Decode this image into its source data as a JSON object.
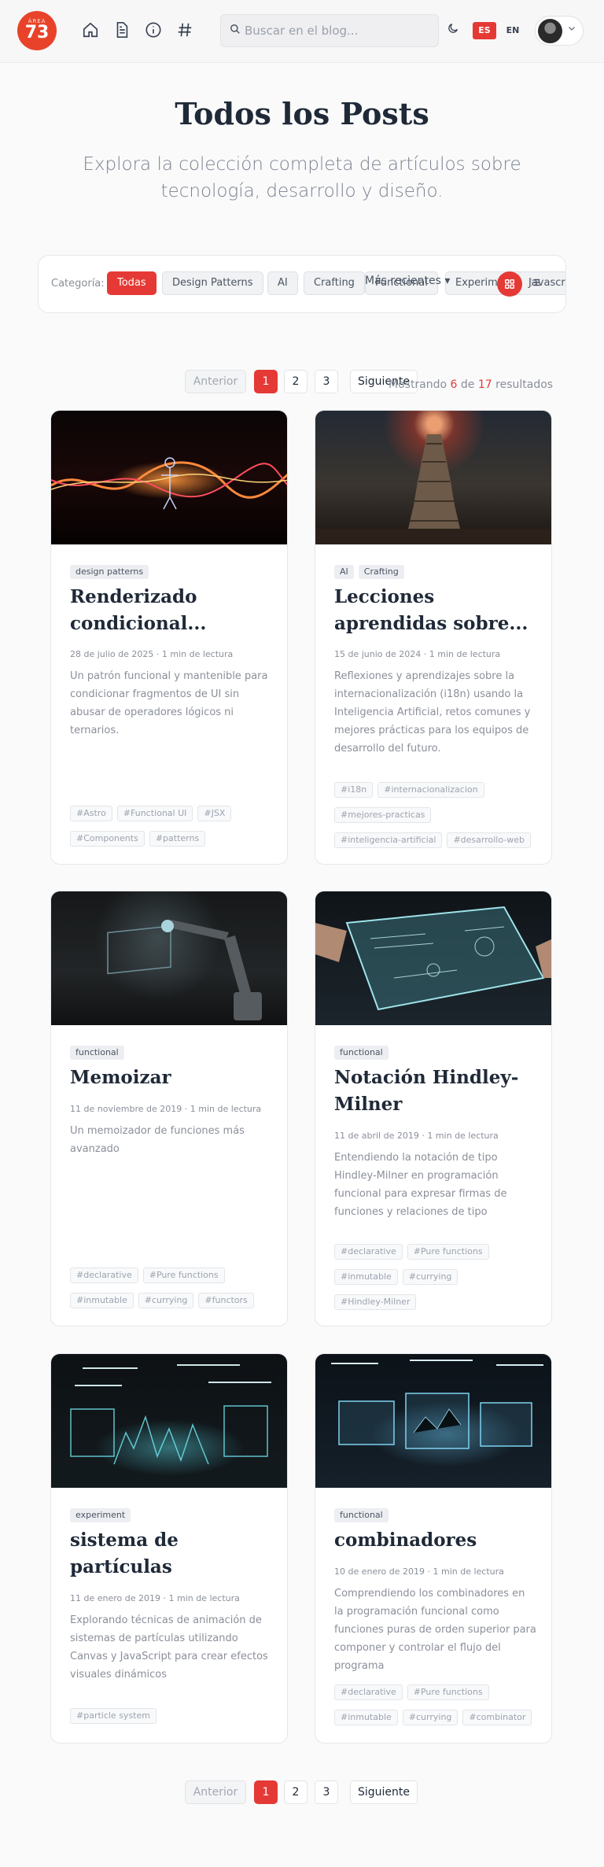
{
  "header": {
    "logo_top": "ÁREA",
    "logo_num": "73",
    "search_placeholder": "Buscar en el blog...",
    "lang_es": "ES",
    "lang_en": "EN"
  },
  "hero": {
    "title": "Todos los Posts",
    "subtitle": "Explora la colección completa de artículos sobre tecnología, desarrollo y diseño."
  },
  "filter": {
    "category_label": "Categoría:",
    "chips": [
      "Todas",
      "Design Patterns",
      "AI",
      "Crafting",
      "Functional",
      "Experiment",
      "Javascript"
    ],
    "sort_label": "Más recientes",
    "sort_selected": "Más recientes"
  },
  "pagination": {
    "prev": "Anterior",
    "pages": [
      "1",
      "2",
      "3"
    ],
    "next": "Siguiente"
  },
  "results": {
    "prefix": "Mostrando",
    "shown": "6",
    "middle": "de",
    "total": "17",
    "suffix": "resultados"
  },
  "posts": [
    {
      "categories": [
        "design patterns"
      ],
      "title": "Renderizado condicional...",
      "date": "28 de julio de 2025",
      "read_time": "1 min de lectura",
      "description": "Un patrón funcional y mantenible para condicionar fragmentos de UI sin abusar de operadores lógicos ni ternarios.",
      "tags": [
        "#Astro",
        "#Functional UI",
        "#JSX",
        "#Components",
        "#patterns"
      ]
    },
    {
      "categories": [
        "AI",
        "Crafting"
      ],
      "title": "Lecciones aprendidas sobre...",
      "date": "15 de junio de 2024",
      "read_time": "1 min de lectura",
      "description": "Reflexiones y aprendizajes sobre la internacionalización (i18n) usando la Inteligencia Artificial, retos comunes y mejores prácticas para los equipos de desarrollo del futuro.",
      "tags": [
        "#i18n",
        "#internacionalizacion",
        "#mejores-practicas",
        "#inteligencia-artificial",
        "#desarrollo-web"
      ]
    },
    {
      "categories": [
        "functional"
      ],
      "title": "Memoizar",
      "date": "11 de noviembre de 2019",
      "read_time": "1 min de lectura",
      "description": "Un memoizador de funciones más avanzado",
      "tags": [
        "#declarative",
        "#Pure functions",
        "#inmutable",
        "#currying",
        "#functors"
      ]
    },
    {
      "categories": [
        "functional"
      ],
      "title": "Notación Hindley-Milner",
      "date": "11 de abril de 2019",
      "read_time": "1 min de lectura",
      "description": "Entendiendo la notación de tipo Hindley-Milner en programación funcional para expresar firmas de funciones y relaciones de tipo",
      "tags": [
        "#declarative",
        "#Pure functions",
        "#inmutable",
        "#currying",
        "#Hindley-Milner"
      ]
    },
    {
      "categories": [
        "experiment"
      ],
      "title": "sistema de partículas",
      "date": "11 de enero de 2019",
      "read_time": "1 min de lectura",
      "description": "Explorando técnicas de animación de sistemas de partículas utilizando Canvas y JavaScript para crear efectos visuales dinámicos",
      "tags": [
        "#particle system"
      ]
    },
    {
      "categories": [
        "functional"
      ],
      "title": "combinadores",
      "date": "10 de enero de 2019",
      "read_time": "1 min de lectura",
      "description": "Comprendiendo los combinadores en la programación funcional como funciones puras de orden superior para componer y controlar el flujo del programa",
      "tags": [
        "#declarative",
        "#Pure functions",
        "#inmutable",
        "#currying",
        "#combinator"
      ]
    }
  ],
  "colors": {
    "accent": "#e53935",
    "logo": "#e8432a"
  },
  "icons": {
    "home": "home-icon",
    "document": "document-icon",
    "info": "info-icon",
    "hash": "hash-icon",
    "search": "search-icon",
    "theme": "moon-icon",
    "view_grid": "grid-icon",
    "view_list": "list-icon"
  }
}
